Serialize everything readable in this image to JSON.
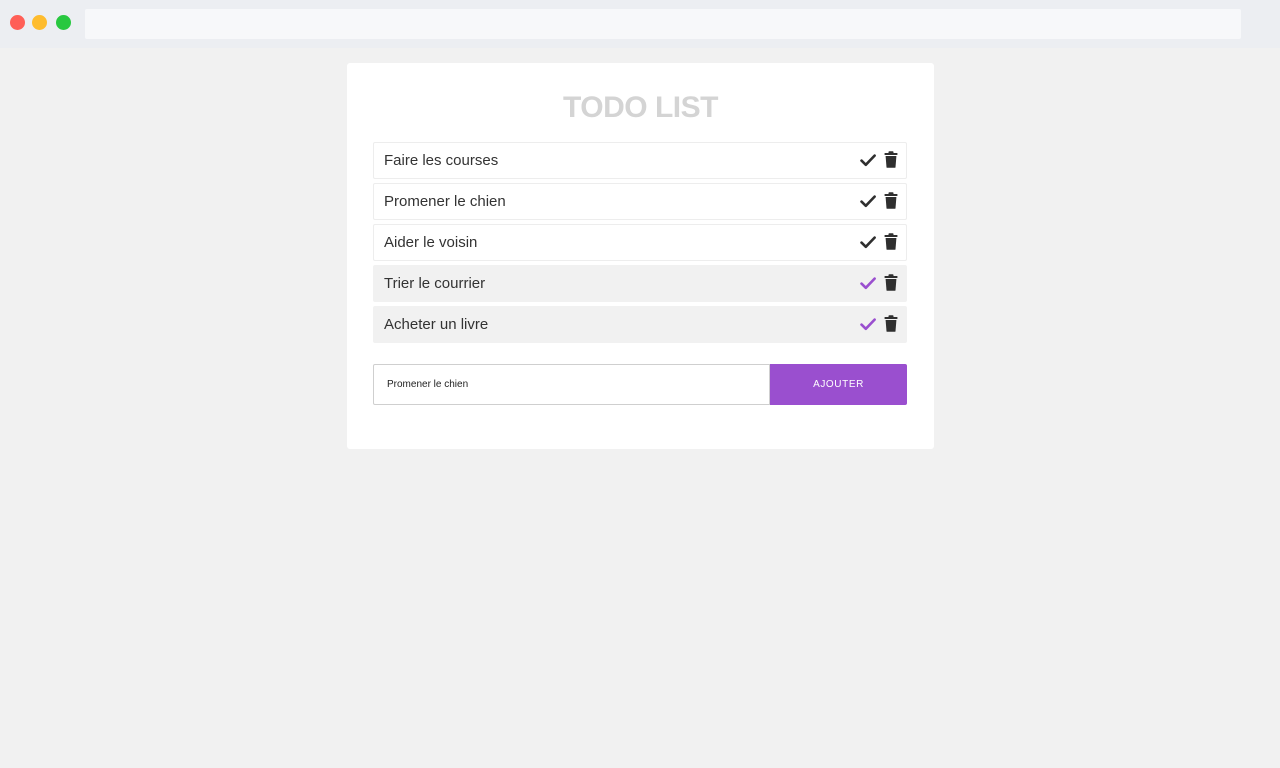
{
  "app": {
    "title": "TODO LIST"
  },
  "todos": [
    {
      "label": "Faire les courses",
      "done": false
    },
    {
      "label": "Promener le chien",
      "done": false
    },
    {
      "label": "Aider le voisin",
      "done": false
    },
    {
      "label": "Trier le courrier",
      "done": true
    },
    {
      "label": "Acheter un livre",
      "done": true
    }
  ],
  "form": {
    "input_value": "Promener le chien",
    "add_label": "AJOUTER"
  },
  "icons": {
    "check": "check-icon",
    "delete": "trash-icon"
  },
  "colors": {
    "accent": "#9a4fcf",
    "check_default": "#2f2f2f",
    "title": "#d4d4d4",
    "done_row": "#f1f1f1"
  }
}
